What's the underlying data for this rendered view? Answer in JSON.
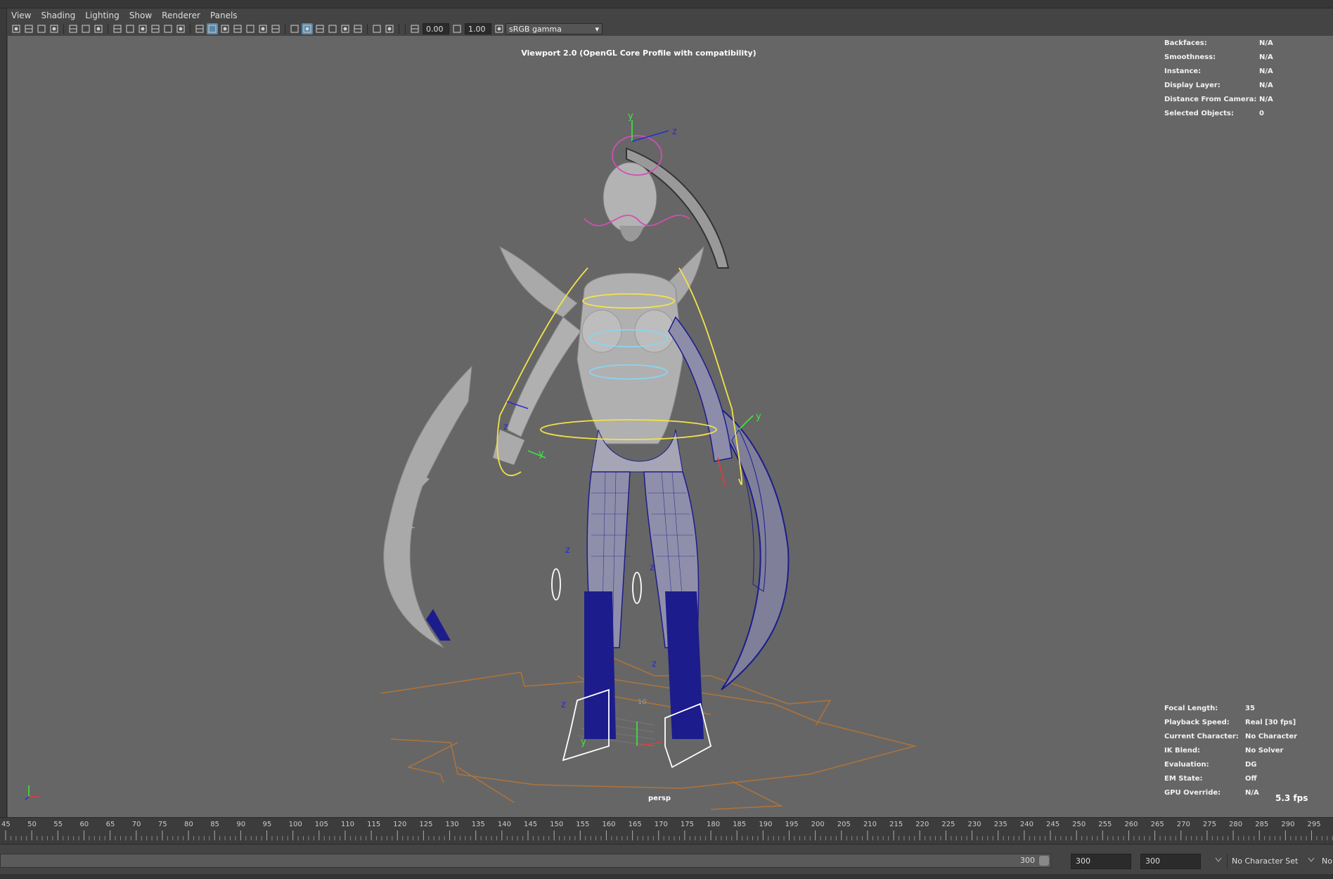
{
  "menubar": {
    "items": [
      "View",
      "Shading",
      "Lighting",
      "Show",
      "Renderer",
      "Panels"
    ]
  },
  "toolbar": {
    "exposure": "0.00",
    "gamma": "1.00",
    "color_space": "sRGB gamma",
    "icons": [
      "camera-select-icon",
      "camera-attributes-icon",
      "camera-bookmark-icon",
      "image-plane-icon",
      "2d-pan-zoom-icon",
      "grease-pencil-icon",
      "grid-icon",
      "film-gate-icon",
      "resolution-gate-icon",
      "gate-mask-icon",
      "field-chart-icon",
      "safe-action-icon",
      "safe-title-icon",
      "wireframe-icon",
      "smooth-shade-icon",
      "default-material-icon",
      "wireframe-on-shaded-icon",
      "textured-icon",
      "use-all-lights-icon",
      "shadows-icon",
      "screen-space-ao-icon",
      "motion-blur-icon",
      "multisample-aa-icon",
      "depth-of-field-icon",
      "isolate-select-icon",
      "xray-icon",
      "xray-joints-icon",
      "backface-culling-icon",
      "exposure-icon",
      "gamma-icon",
      "color-management-icon"
    ]
  },
  "viewport": {
    "title": "Viewport 2.0 (OpenGL Core Profile with compatibility)",
    "camera": "persp",
    "fps": "5.3 fps",
    "hud_top": [
      {
        "key": "Backfaces:",
        "value": "N/A"
      },
      {
        "key": "Smoothness:",
        "value": "N/A"
      },
      {
        "key": "Instance:",
        "value": "N/A"
      },
      {
        "key": "Display Layer:",
        "value": "N/A"
      },
      {
        "key": "Distance From Camera:",
        "value": "N/A"
      },
      {
        "key": "Selected Objects:",
        "value": "0"
      }
    ],
    "hud_bottom": [
      {
        "key": "Focal Length:",
        "value": "35"
      },
      {
        "key": "Playback Speed:",
        "value": "Real [30 fps]"
      },
      {
        "key": "Current Character:",
        "value": "No Character"
      },
      {
        "key": "IK Blend:",
        "value": "No Solver"
      },
      {
        "key": "Evaluation:",
        "value": "DG"
      },
      {
        "key": "EM State:",
        "value": "Off"
      },
      {
        "key": "GPU Override:",
        "value": "N/A"
      }
    ],
    "ground_label": "10",
    "axis_labels": [
      "x",
      "y",
      "z"
    ]
  },
  "timeline": {
    "ticks": [
      "45",
      "50",
      "55",
      "60",
      "65",
      "70",
      "75",
      "80",
      "85",
      "90",
      "95",
      "100",
      "105",
      "110",
      "115",
      "120",
      "125",
      "130",
      "135",
      "140",
      "145",
      "150",
      "155",
      "160",
      "165",
      "170",
      "175",
      "180",
      "185",
      "190",
      "195",
      "200",
      "205",
      "210",
      "215",
      "220",
      "225",
      "230",
      "235",
      "240",
      "245",
      "250",
      "255",
      "260",
      "265",
      "270",
      "275",
      "280",
      "285",
      "290",
      "295"
    ]
  },
  "range": {
    "end_label": "300",
    "start_value": "300",
    "end_value": "300",
    "character_set": "No Character Set",
    "trailing_label": "No"
  },
  "colors": {
    "viewport_bg": "#666666",
    "panel_bg": "#444444",
    "wire_blue": "#1c1c8c",
    "ctrl_yellow": "#f2e34a",
    "ctrl_magenta": "#d04fb3",
    "ctrl_cyan": "#8cd3f0",
    "axis_green": "#3ee83e",
    "axis_blue": "#2a2ad8",
    "ground_orange": "#b0743a",
    "model_grey": "#a9a9a9"
  }
}
